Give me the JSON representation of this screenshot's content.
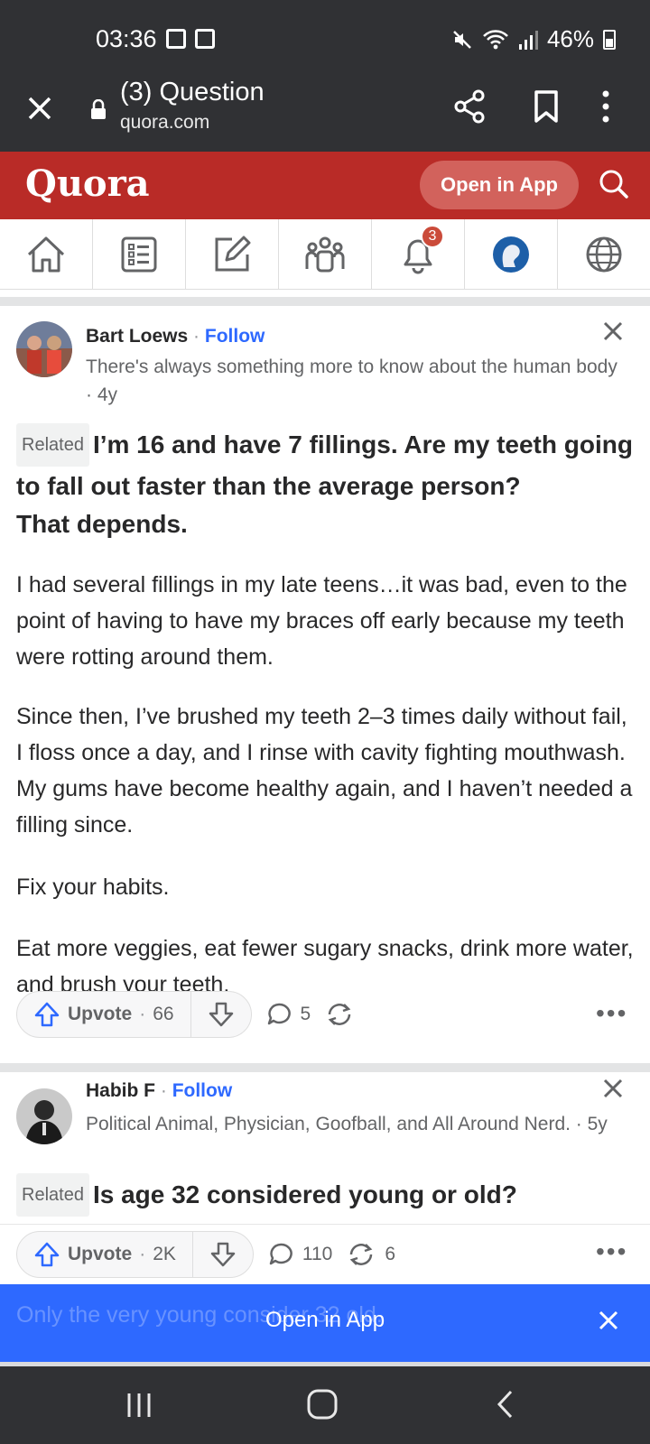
{
  "status_bar": {
    "time": "03:36",
    "battery": "46%"
  },
  "browser": {
    "title": "(3) Question",
    "url": "quora.com"
  },
  "header": {
    "logo": "Quora",
    "open_app": "Open in App"
  },
  "nav": {
    "notifications_badge": "3"
  },
  "answers": [
    {
      "author": "Bart Loews",
      "sep": "·",
      "follow": "Follow",
      "credential": "There's always something more to know about the human body · 4y",
      "related": "Related",
      "question": "I’m 16 and have 7 fillings. Are my teeth going to fall out faster than the average person?",
      "lead": "That depends.",
      "paragraphs": [
        "I had several fillings in my late teens…it was bad, even to the point of having to have my braces off early because my teeth were rotting around them.",
        "Since then, I’ve brushed my teeth 2–3 times daily without fail, I floss once a day, and I rinse with cavity fighting mouthwash. My gums have become healthy again, and I haven’t needed a filling since.",
        "Fix your habits.",
        "Eat more veggies, eat fewer sugary snacks, drink more water, and brush your teeth."
      ],
      "upvote_label": "Upvote",
      "upvotes": "66",
      "comments": "5",
      "shares": ""
    },
    {
      "author": "Habib F",
      "sep": "·",
      "follow": "Follow",
      "credential": "Political Animal, Physician, Goofball, and All Around Nerd. · 5y",
      "related": "Related",
      "question": "Is age 32 considered young or old?",
      "upvote_label": "Upvote",
      "upvotes": "2K",
      "comments": "110",
      "shares": "6",
      "preview_text": "Only the very young consider 32 old."
    }
  ],
  "banner": {
    "label": "Open in App"
  },
  "colors": {
    "quora_red": "#b92b27",
    "link_blue": "#2e69ff",
    "dark_bar": "#303134"
  }
}
